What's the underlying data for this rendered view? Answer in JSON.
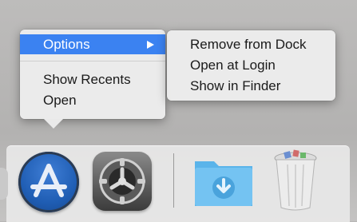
{
  "context_menu": {
    "items": [
      {
        "label": "Options",
        "selected": true,
        "has_submenu": true
      },
      {
        "label": "Show Recents"
      },
      {
        "label": "Open"
      }
    ]
  },
  "submenu": {
    "items": [
      {
        "label": "Remove from Dock"
      },
      {
        "label": "Open at Login"
      },
      {
        "label": "Show in Finder"
      }
    ]
  },
  "dock": {
    "icons": [
      {
        "name": "app-store-icon"
      },
      {
        "name": "system-preferences-icon"
      },
      {
        "name": "downloads-folder-icon"
      },
      {
        "name": "trash-icon"
      }
    ]
  },
  "colors": {
    "highlight": "#3b82f1",
    "menu_bg": "#ececec",
    "dock_bg": "#e8e8e8"
  }
}
